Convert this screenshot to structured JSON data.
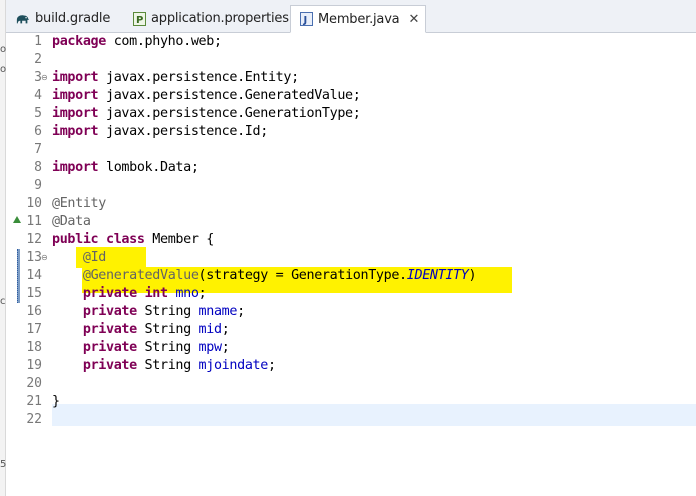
{
  "left_strip": {
    "fragments": [
      "o",
      "o",
      "ci",
      "5"
    ]
  },
  "tabs": [
    {
      "label": "build.gradle",
      "icon": "gradle-elephant-icon",
      "active": false
    },
    {
      "label": "application.properties",
      "icon": "properties-file-icon",
      "active": false
    },
    {
      "label": "Member.java",
      "icon": "java-file-icon",
      "active": true
    }
  ],
  "editor": {
    "lines": [
      {
        "n": "1",
        "segs": [
          [
            "kw",
            "package"
          ],
          [
            "t",
            " com.phyho.web;"
          ]
        ]
      },
      {
        "n": "2",
        "segs": []
      },
      {
        "n": "3",
        "segs": [
          [
            "kw",
            "import"
          ],
          [
            "t",
            " javax.persistence.Entity;"
          ]
        ],
        "fold": "⊖"
      },
      {
        "n": "4",
        "segs": [
          [
            "kw",
            "import"
          ],
          [
            "t",
            " javax.persistence.GeneratedValue;"
          ]
        ]
      },
      {
        "n": "5",
        "segs": [
          [
            "kw",
            "import"
          ],
          [
            "t",
            " javax.persistence.GenerationType;"
          ]
        ]
      },
      {
        "n": "6",
        "segs": [
          [
            "kw",
            "import"
          ],
          [
            "t",
            " javax.persistence.Id;"
          ]
        ]
      },
      {
        "n": "7",
        "segs": []
      },
      {
        "n": "8",
        "segs": [
          [
            "kw",
            "import"
          ],
          [
            "t",
            " lombok.Data;"
          ]
        ]
      },
      {
        "n": "9",
        "segs": []
      },
      {
        "n": "10",
        "segs": [
          [
            "ann",
            "@Entity"
          ]
        ]
      },
      {
        "n": "11",
        "segs": [
          [
            "ann",
            "@Data"
          ]
        ],
        "overview_marker": true
      },
      {
        "n": "12",
        "segs": [
          [
            "kw",
            "public"
          ],
          [
            "t",
            " "
          ],
          [
            "kw",
            "class"
          ],
          [
            "t",
            " Member {"
          ]
        ]
      },
      {
        "n": "13",
        "segs": [
          [
            "t",
            "    "
          ],
          [
            "ann",
            "@Id"
          ]
        ],
        "fold": "⊖"
      },
      {
        "n": "14",
        "segs": [
          [
            "t",
            "    "
          ],
          [
            "ann",
            "@GeneratedValue"
          ],
          [
            "t",
            "(strategy = GenerationType."
          ],
          [
            "it",
            "IDENTITY"
          ],
          [
            "t",
            ")"
          ]
        ]
      },
      {
        "n": "15",
        "segs": [
          [
            "t",
            "    "
          ],
          [
            "kw",
            "private"
          ],
          [
            "t",
            " "
          ],
          [
            "kw",
            "int"
          ],
          [
            "t",
            " "
          ],
          [
            "fld",
            "mno"
          ],
          [
            "t",
            ";"
          ]
        ]
      },
      {
        "n": "16",
        "segs": [
          [
            "t",
            "    "
          ],
          [
            "kw",
            "private"
          ],
          [
            "t",
            " String "
          ],
          [
            "fld",
            "mname"
          ],
          [
            "t",
            ";"
          ]
        ]
      },
      {
        "n": "17",
        "segs": [
          [
            "t",
            "    "
          ],
          [
            "kw",
            "private"
          ],
          [
            "t",
            " String "
          ],
          [
            "fld",
            "mid"
          ],
          [
            "t",
            ";"
          ]
        ]
      },
      {
        "n": "18",
        "segs": [
          [
            "t",
            "    "
          ],
          [
            "kw",
            "private"
          ],
          [
            "t",
            " String "
          ],
          [
            "fld",
            "mpw"
          ],
          [
            "t",
            ";"
          ]
        ]
      },
      {
        "n": "19",
        "segs": [
          [
            "t",
            "    "
          ],
          [
            "kw",
            "private"
          ],
          [
            "t",
            " String "
          ],
          [
            "fld",
            "mjoindate"
          ],
          [
            "t",
            ";"
          ]
        ]
      },
      {
        "n": "20",
        "segs": []
      },
      {
        "n": "21",
        "segs": [
          [
            "t",
            "}"
          ]
        ]
      },
      {
        "n": "22",
        "segs": []
      }
    ]
  },
  "colors": {
    "keyword": "#7f0055",
    "annotation": "#646464",
    "field": "#0000c0",
    "highlight": "#fff200",
    "current_line": "#e8f2fe"
  }
}
